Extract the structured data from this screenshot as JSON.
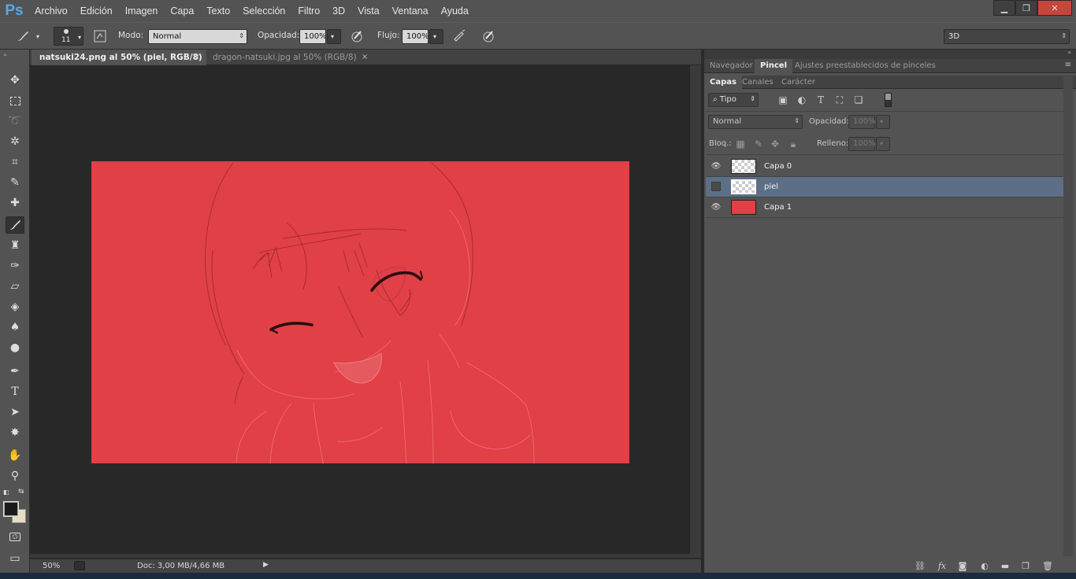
{
  "app": {
    "logo": "Ps"
  },
  "menu": [
    "Archivo",
    "Edición",
    "Imagen",
    "Capa",
    "Texto",
    "Selección",
    "Filtro",
    "3D",
    "Vista",
    "Ventana",
    "Ayuda"
  ],
  "window_controls": {
    "minimize": "▁",
    "restore": "❐",
    "close": "✕"
  },
  "options": {
    "brush_size": "11",
    "mode_label": "Modo:",
    "mode_value": "Normal",
    "opacity_label": "Opacidad:",
    "opacity_value": "100%",
    "flow_label": "Flujo:",
    "flow_value": "100%",
    "workspace": "3D"
  },
  "doc_tabs": [
    {
      "title": "natsuki24.png al 50% (piel, RGB/8) *",
      "active": true
    },
    {
      "title": "dragon-natsuki.jpg al 50% (RGB/8)",
      "active": false
    }
  ],
  "close_glyph": "×",
  "canvas": {
    "background": "#e04046"
  },
  "status": {
    "zoom": "50%",
    "doc": "Doc: 3,00 MB/4,66 MB"
  },
  "panel_tabs_top": [
    {
      "label": "Navegador",
      "active": false
    },
    {
      "label": "Pincel",
      "active": true
    },
    {
      "label": "Ajustes preestablecidos de pinceles",
      "active": false
    }
  ],
  "panel_tabs_layers": [
    {
      "label": "Capas",
      "active": true
    },
    {
      "label": "Canales",
      "active": false
    },
    {
      "label": "Carácter",
      "active": false
    }
  ],
  "layers_panel": {
    "filter_kind": "Tipo",
    "blend_mode": "Normal",
    "opacity_label": "Opacidad:",
    "opacity_value": "100%",
    "lock_label": "Bloq.:",
    "fill_label": "Relleno:",
    "fill_value": "100%"
  },
  "layers": [
    {
      "name": "Capa 0",
      "visible": true,
      "selected": false,
      "thumb": "transparent"
    },
    {
      "name": "piel",
      "visible": false,
      "selected": true,
      "thumb": "transparent"
    },
    {
      "name": "Capa 1",
      "visible": true,
      "selected": false,
      "thumb": "red"
    }
  ],
  "colors": {
    "foreground": "#1a1a1a",
    "background": "#e8dcc0",
    "accent": "#5aa8e8"
  }
}
